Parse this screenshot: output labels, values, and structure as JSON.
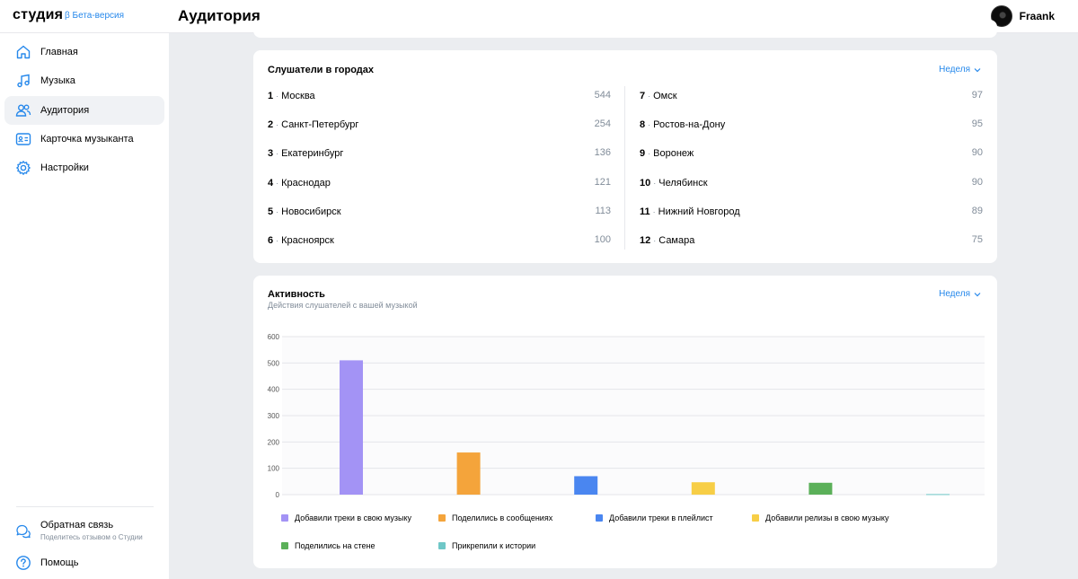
{
  "header": {
    "logo": "студия",
    "beta": "β Бета-версия",
    "page_title": "Аудитория",
    "user_name": "Fraank"
  },
  "sidebar": {
    "items": [
      {
        "label": "Главная",
        "icon": "home-icon"
      },
      {
        "label": "Музыка",
        "icon": "music-note-icon"
      },
      {
        "label": "Аудитория",
        "icon": "users-icon",
        "active": true
      },
      {
        "label": "Карточка музыканта",
        "icon": "id-card-icon"
      },
      {
        "label": "Настройки",
        "icon": "gear-icon"
      }
    ],
    "feedback": {
      "title": "Обратная связь",
      "subtitle": "Поделитесь отзывом о Студии",
      "icon": "chat-bubbles-icon"
    },
    "help": {
      "label": "Помощь",
      "icon": "question-circle-icon"
    }
  },
  "cities": {
    "title": "Слушатели в городах",
    "period": "Неделя",
    "left": [
      {
        "rank": "1",
        "name": "Москва",
        "value": "544"
      },
      {
        "rank": "2",
        "name": "Санкт-Петербург",
        "value": "254"
      },
      {
        "rank": "3",
        "name": "Екатеринбург",
        "value": "136"
      },
      {
        "rank": "4",
        "name": "Краснодар",
        "value": "121"
      },
      {
        "rank": "5",
        "name": "Новосибирск",
        "value": "113"
      },
      {
        "rank": "6",
        "name": "Красноярск",
        "value": "100"
      }
    ],
    "right": [
      {
        "rank": "7",
        "name": "Омск",
        "value": "97"
      },
      {
        "rank": "8",
        "name": "Ростов-на-Дону",
        "value": "95"
      },
      {
        "rank": "9",
        "name": "Воронеж",
        "value": "90"
      },
      {
        "rank": "10",
        "name": "Челябинск",
        "value": "90"
      },
      {
        "rank": "11",
        "name": "Нижний Новгород",
        "value": "89"
      },
      {
        "rank": "12",
        "name": "Самара",
        "value": "75"
      }
    ]
  },
  "activity": {
    "title": "Активность",
    "subtitle": "Действия слушателей с вашей музыкой",
    "period": "Неделя"
  },
  "chart_data": {
    "type": "bar",
    "categories": [
      "Добавили треки в свою музыку",
      "Поделились в сообщениях",
      "Добавили треки в плейлист",
      "Добавили релизы в свою музыку",
      "Поделились на стене",
      "Прикрепили к истории"
    ],
    "values": [
      510,
      160,
      70,
      47,
      45,
      2
    ],
    "colors": [
      "#a393f5",
      "#f4a43b",
      "#4a86f0",
      "#f7ce46",
      "#5bb059",
      "#6fc7c7"
    ],
    "ylim": [
      0,
      600
    ],
    "yticks": [
      0,
      100,
      200,
      300,
      400,
      500,
      600
    ],
    "grid": true,
    "legend": "bottom",
    "title": "",
    "xlabel": "",
    "ylabel": ""
  }
}
